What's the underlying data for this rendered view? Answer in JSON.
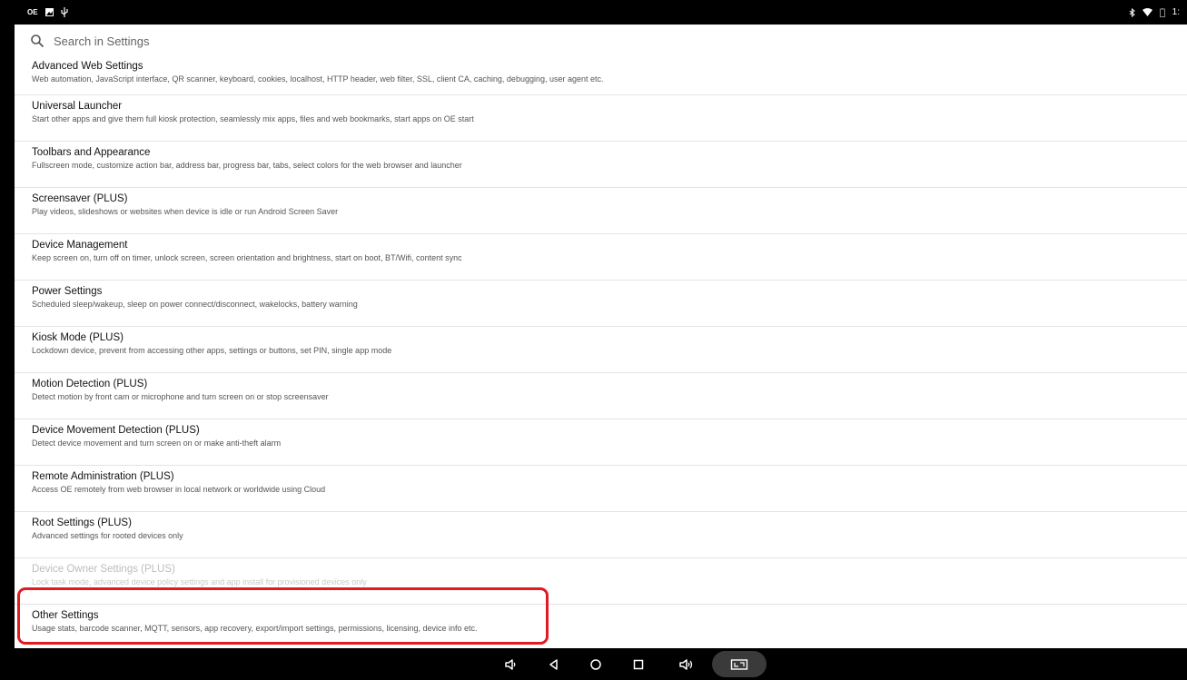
{
  "status_bar": {
    "left_icons": [
      "notification-icon",
      "image-icon",
      "usb-icon"
    ],
    "left_text": "OE",
    "right_icons": [
      "bluetooth-icon",
      "wifi-icon",
      "battery-icon"
    ],
    "time": "1:"
  },
  "search": {
    "placeholder": "Search in Settings"
  },
  "settings": [
    {
      "title": "Advanced Web Settings",
      "desc": "Web automation, JavaScript interface, QR scanner, keyboard, cookies, localhost, HTTP header, web filter, SSL, client CA, caching, debugging, user agent etc.",
      "enabled": true
    },
    {
      "title": "Universal Launcher",
      "desc": "Start other apps and give them full kiosk protection, seamlessly mix apps, files and web bookmarks, start apps on OE start",
      "enabled": true
    },
    {
      "title": "Toolbars and Appearance",
      "desc": "Fullscreen mode, customize action bar, address bar, progress bar, tabs, select colors for the web browser and launcher",
      "enabled": true
    },
    {
      "title": "Screensaver (PLUS)",
      "desc": "Play videos, slideshows or websites when device is idle or run Android Screen Saver",
      "enabled": true
    },
    {
      "title": "Device Management",
      "desc": "Keep screen on, turn off on timer, unlock screen, screen orientation and brightness, start on boot, BT/Wifi, content sync",
      "enabled": true
    },
    {
      "title": "Power Settings",
      "desc": "Scheduled sleep/wakeup, sleep on power connect/disconnect, wakelocks, battery warning",
      "enabled": true
    },
    {
      "title": "Kiosk Mode (PLUS)",
      "desc": "Lockdown device, prevent from accessing other apps, settings or buttons, set PIN, single app mode",
      "enabled": true
    },
    {
      "title": "Motion Detection (PLUS)",
      "desc": "Detect motion by front cam or microphone and turn screen on or stop screensaver",
      "enabled": true
    },
    {
      "title": "Device Movement Detection (PLUS)",
      "desc": "Detect device movement and turn screen on or make anti-theft alarm",
      "enabled": true
    },
    {
      "title": "Remote Administration (PLUS)",
      "desc": "Access OE remotely from web browser in local network or worldwide using Cloud",
      "enabled": true
    },
    {
      "title": "Root Settings (PLUS)",
      "desc": "Advanced settings for rooted devices only",
      "enabled": true
    },
    {
      "title": "Device Owner Settings (PLUS)",
      "desc": "Lock task mode, advanced device policy settings and app install for provisioned devices only",
      "enabled": false
    },
    {
      "title": "Other Settings",
      "desc": "Usage stats, barcode scanner, MQTT, sensors, app recovery, export/import settings, permissions, licensing, device info etc.",
      "enabled": true
    }
  ],
  "highlight": {
    "target": "Other Settings",
    "color": "#e01b22"
  },
  "nav_bar": {
    "buttons": [
      "volume-down-icon",
      "back-icon",
      "home-icon",
      "recents-icon",
      "volume-up-icon",
      "screenshot-icon"
    ]
  }
}
